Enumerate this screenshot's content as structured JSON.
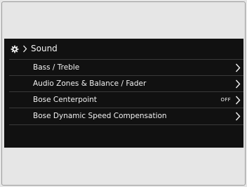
{
  "header": {
    "icon": "gear-icon",
    "separator_icon": "chevron-right-icon",
    "title": "Sound"
  },
  "menu": {
    "items": [
      {
        "label": "Bass / Treble",
        "value": "",
        "icon": "chevron-right-icon"
      },
      {
        "label": "Audio Zones & Balance / Fader",
        "value": "",
        "icon": "chevron-right-icon"
      },
      {
        "label": "Bose Centerpoint",
        "value": "OFF",
        "icon": "chevron-right-icon"
      },
      {
        "label": "Bose Dynamic Speed Compensation",
        "value": "",
        "icon": "chevron-right-icon"
      }
    ]
  },
  "colors": {
    "screen_background": "#111111",
    "text": "#f2f2f2",
    "divider": "#3a3a3a",
    "outer_background": "#e6e6e6"
  }
}
